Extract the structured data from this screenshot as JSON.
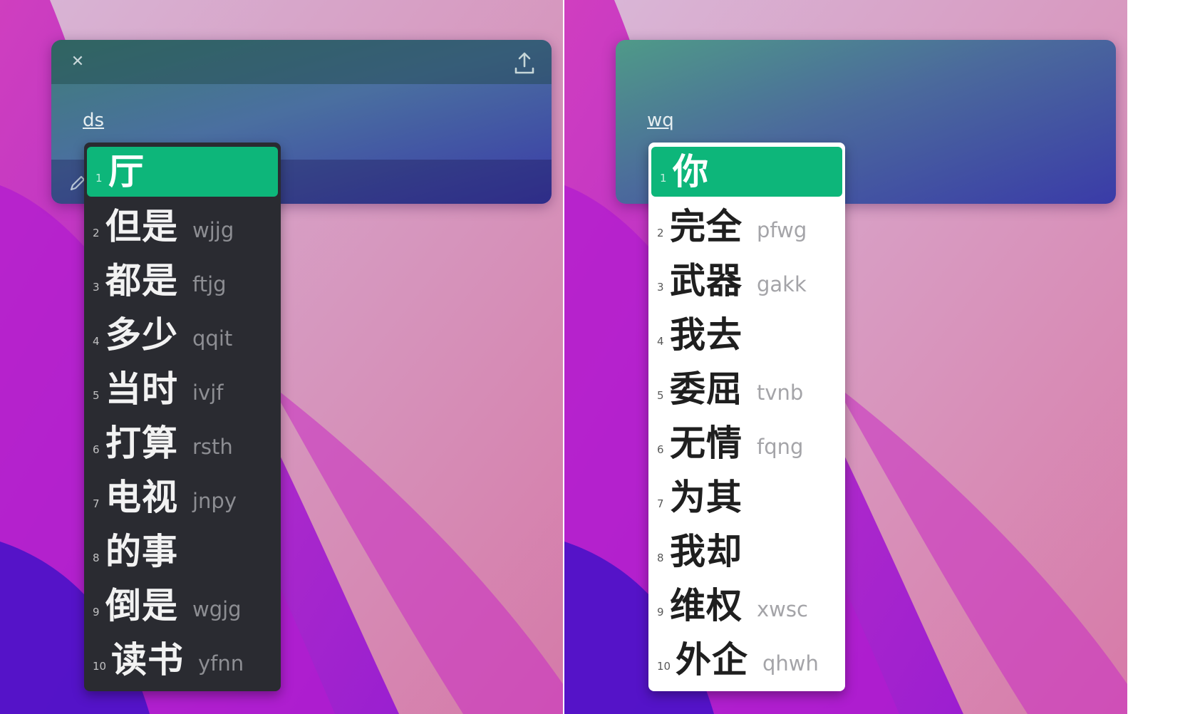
{
  "colors": {
    "accent": "#0db67a",
    "dark_list_bg": "#2a2b31",
    "light_list_bg": "#ffffff"
  },
  "left": {
    "theme": "dark",
    "input_code": "ds",
    "icons": [
      "close-icon",
      "share-icon",
      "pen-icon"
    ],
    "candidates": [
      {
        "num": "1",
        "word": "厅",
        "code": ""
      },
      {
        "num": "2",
        "word": "但是",
        "code": "wjjg"
      },
      {
        "num": "3",
        "word": "都是",
        "code": "ftjg"
      },
      {
        "num": "4",
        "word": "多少",
        "code": "qqit"
      },
      {
        "num": "5",
        "word": "当时",
        "code": "ivjf"
      },
      {
        "num": "6",
        "word": "打算",
        "code": "rsth"
      },
      {
        "num": "7",
        "word": "电视",
        "code": "jnpy"
      },
      {
        "num": "8",
        "word": "的事",
        "code": ""
      },
      {
        "num": "9",
        "word": "倒是",
        "code": "wgjg"
      },
      {
        "num": "10",
        "word": "读书",
        "code": "yfnn"
      }
    ]
  },
  "right": {
    "theme": "light",
    "input_code": "wq",
    "candidates": [
      {
        "num": "1",
        "word": "你",
        "code": ""
      },
      {
        "num": "2",
        "word": "完全",
        "code": "pfwg"
      },
      {
        "num": "3",
        "word": "武器",
        "code": "gakk"
      },
      {
        "num": "4",
        "word": "我去",
        "code": ""
      },
      {
        "num": "5",
        "word": "委屈",
        "code": "tvnb"
      },
      {
        "num": "6",
        "word": "无情",
        "code": "fqng"
      },
      {
        "num": "7",
        "word": "为其",
        "code": ""
      },
      {
        "num": "8",
        "word": "我却",
        "code": ""
      },
      {
        "num": "9",
        "word": "维权",
        "code": "xwsc"
      },
      {
        "num": "10",
        "word": "外企",
        "code": "qhwh"
      }
    ]
  }
}
